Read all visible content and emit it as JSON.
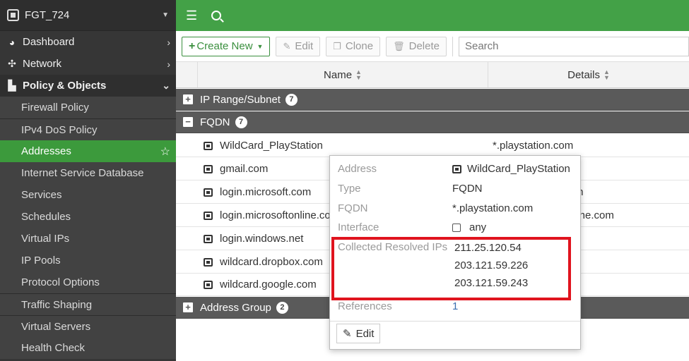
{
  "sidebar": {
    "device": "FGT_724",
    "items": [
      {
        "label": "Dashboard",
        "icon": "dashboard-icon"
      },
      {
        "label": "Network",
        "icon": "network-icon"
      },
      {
        "label": "Policy & Objects",
        "icon": "policy-icon"
      }
    ],
    "sub_items": [
      {
        "label": "Firewall Policy"
      },
      {
        "label": "IPv4 DoS Policy"
      },
      {
        "label": "Addresses"
      },
      {
        "label": "Internet Service Database"
      },
      {
        "label": "Services"
      },
      {
        "label": "Schedules"
      },
      {
        "label": "Virtual IPs"
      },
      {
        "label": "IP Pools"
      },
      {
        "label": "Protocol Options"
      },
      {
        "label": "Traffic Shaping"
      },
      {
        "label": "Virtual Servers"
      },
      {
        "label": "Health Check"
      }
    ]
  },
  "toolbar": {
    "create_label": "Create New",
    "edit_label": "Edit",
    "clone_label": "Clone",
    "delete_label": "Delete",
    "search_placeholder": "Search"
  },
  "table": {
    "columns": [
      "Name",
      "Details"
    ],
    "groups": [
      {
        "label": "IP Range/Subnet",
        "count": "7"
      },
      {
        "label": "FQDN",
        "count": "7"
      },
      {
        "label": "Address Group",
        "count": "2"
      }
    ],
    "rows": [
      {
        "name": "WildCard_PlayStation",
        "details": "*.playstation.com"
      },
      {
        "name": "gmail.com",
        "details": ""
      },
      {
        "name": "login.microsoft.com",
        "details": "m"
      },
      {
        "name": "login.microsoftonline.co",
        "details": "line.com"
      },
      {
        "name": "login.windows.net",
        "details": ""
      },
      {
        "name": "wildcard.dropbox.com",
        "details": ""
      },
      {
        "name": "wildcard.google.com",
        "details": ""
      }
    ]
  },
  "popup": {
    "address_label": "Address",
    "address_value": "WildCard_PlayStation",
    "type_label": "Type",
    "type_value": "FQDN",
    "fqdn_label": "FQDN",
    "fqdn_value": "*.playstation.com",
    "interface_label": "Interface",
    "interface_value": "any",
    "ips_label": "Collected Resolved IPs",
    "ips": [
      "211.25.120.54",
      "203.121.59.226",
      "203.121.59.243"
    ],
    "references_label": "References",
    "references_value": "1",
    "edit_label": "Edit"
  },
  "colors": {
    "accent_green": "#43a147",
    "active_nav": "#3c9a3c",
    "highlight_red": "#e0141e"
  }
}
